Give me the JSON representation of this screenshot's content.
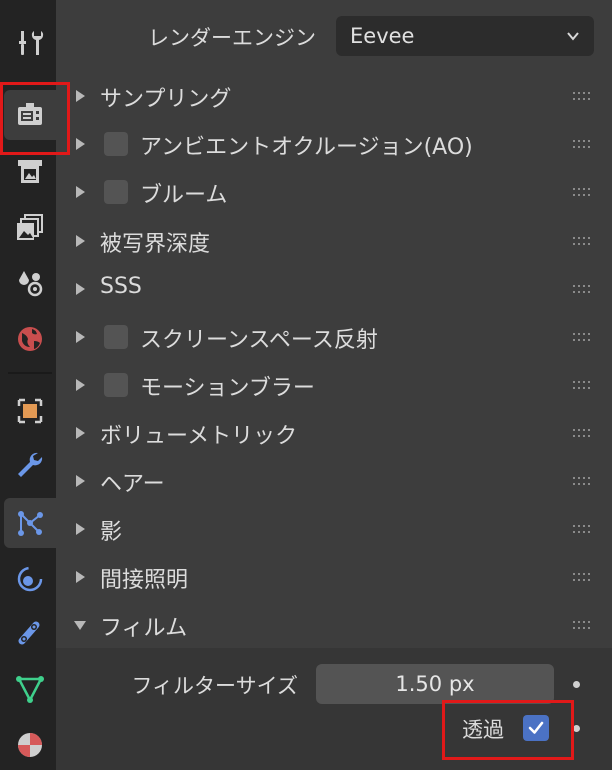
{
  "render_engine": {
    "label": "レンダーエンジン",
    "value": "Eevee"
  },
  "panels": [
    {
      "label": "サンプリング",
      "has_checkbox": false,
      "expanded": false
    },
    {
      "label": "アンビエントオクルージョン(AO)",
      "has_checkbox": true,
      "expanded": false
    },
    {
      "label": "ブルーム",
      "has_checkbox": true,
      "expanded": false
    },
    {
      "label": "被写界深度",
      "has_checkbox": false,
      "expanded": false
    },
    {
      "label": "SSS",
      "has_checkbox": false,
      "expanded": false
    },
    {
      "label": "スクリーンスペース反射",
      "has_checkbox": true,
      "expanded": false
    },
    {
      "label": "モーションブラー",
      "has_checkbox": true,
      "expanded": false
    },
    {
      "label": "ボリューメトリック",
      "has_checkbox": false,
      "expanded": false
    },
    {
      "label": "ヘアー",
      "has_checkbox": false,
      "expanded": false
    },
    {
      "label": "影",
      "has_checkbox": false,
      "expanded": false
    },
    {
      "label": "間接照明",
      "has_checkbox": false,
      "expanded": false
    },
    {
      "label": "フィルム",
      "has_checkbox": false,
      "expanded": true
    }
  ],
  "film": {
    "filter_size_label": "フィルターサイズ",
    "filter_size_value": "1.50 px",
    "transparent_label": "透過",
    "transparent_checked": true
  },
  "sidebar_tabs": [
    {
      "icon": "tool-icon",
      "active": false
    },
    {
      "icon": "render-properties-icon",
      "active": true
    },
    {
      "icon": "output-properties-icon",
      "active": false
    },
    {
      "icon": "view-layer-icon",
      "active": false
    },
    {
      "icon": "scene-icon",
      "active": false
    },
    {
      "icon": "world-icon",
      "active": false
    },
    {
      "icon": "object-icon",
      "active": false
    },
    {
      "icon": "modifier-wrench-icon",
      "active": false
    },
    {
      "icon": "particles-icon",
      "active": true
    },
    {
      "icon": "physics-icon",
      "active": false
    },
    {
      "icon": "constraints-icon",
      "active": false
    },
    {
      "icon": "object-data-icon",
      "active": false
    },
    {
      "icon": "material-icon",
      "active": false
    }
  ],
  "colors": {
    "accent_blue": "#4b72c4",
    "highlight_red": "#e11919",
    "panel_bg": "#3d3d3d"
  }
}
